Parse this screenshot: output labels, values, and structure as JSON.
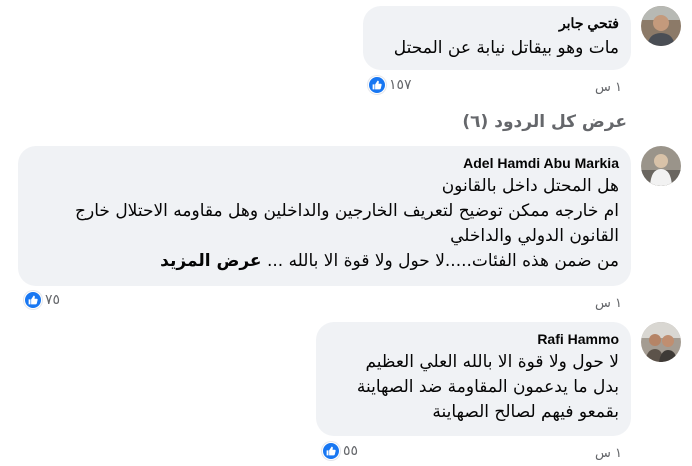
{
  "comments": [
    {
      "author": "فتحي جابر",
      "lines": [
        "مات وهو بيقاتل نيابة عن المحتل"
      ],
      "time": "١ س",
      "reactions": "١٥٧"
    },
    {
      "author": "Adel Hamdi Abu Markia",
      "lines": [
        "هل المحتل داخل بالقانون",
        "ام خارجه ممكن توضيح لتعريف الخارجين والداخلين وهل مقاومه الاحتلال خارج",
        "القانون الدولي والداخلي",
        "من ضمن هذه الفئات.....لا حول ولا قوة الا بالله ..."
      ],
      "see_more": "عرض المزيد",
      "time": "١ س",
      "reactions": "٧٥"
    },
    {
      "author": "Rafi Hammo",
      "lines": [
        "لا حول ولا قوة الا بالله العلي العظيم",
        "بدل ما يدعمون المقاومة ضد الصهاينة",
        "بقمعو فيهم لصالح الصهاينة"
      ],
      "time": "١ س",
      "reactions": "٥٥"
    }
  ],
  "view_replies_label": "عرض كل الردود (٦)",
  "icons": {
    "reaction": "like-icon",
    "avatar": "avatar"
  },
  "colors": {
    "bubble": "#f0f2f5",
    "like": "#1877f2",
    "meta": "#65676b"
  }
}
